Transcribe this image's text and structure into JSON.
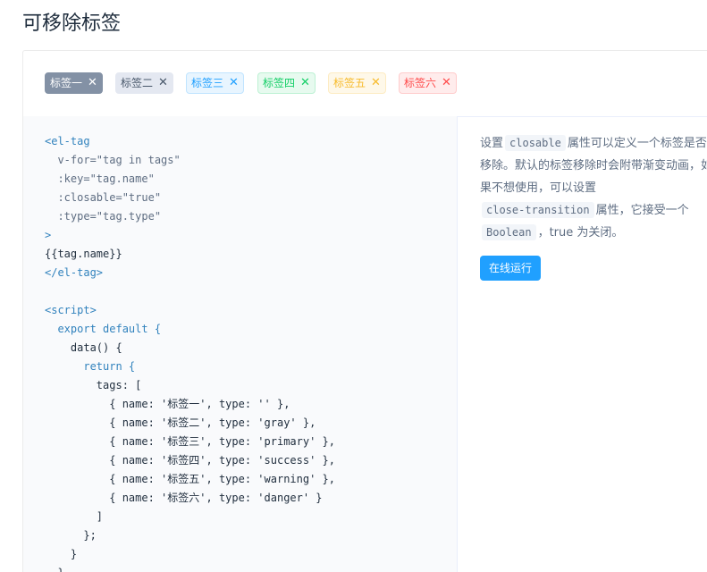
{
  "page": {
    "title": "可移除标签"
  },
  "tags": [
    {
      "label": "标签一",
      "type": "default",
      "close_icon": "close-icon"
    },
    {
      "label": "标签二",
      "type": "gray",
      "close_icon": "close-icon"
    },
    {
      "label": "标签三",
      "type": "primary",
      "close_icon": "close-icon"
    },
    {
      "label": "标签四",
      "type": "success",
      "close_icon": "close-icon"
    },
    {
      "label": "标签五",
      "type": "warning",
      "close_icon": "close-icon"
    },
    {
      "label": "标签六",
      "type": "danger",
      "close_icon": "close-icon"
    }
  ],
  "colors": {
    "default": "#8391a5",
    "gray": "#e4e8f1",
    "primary": "#20a0ff",
    "success": "#13ce66",
    "warning": "#f7ba2a",
    "danger": "#ff4949"
  },
  "code": {
    "lines": [
      "<el-tag",
      "  v-for=\"tag in tags\"",
      "  :key=\"tag.name\"",
      "  :closable=\"true\"",
      "  :type=\"tag.type\"",
      ">",
      "{{tag.name}}",
      "</el-tag>",
      "",
      "<script>",
      "  export default {",
      "    data() {",
      "      return {",
      "        tags: [",
      "          { name: '标签一', type: '' },",
      "          { name: '标签二', type: 'gray' },",
      "          { name: '标签三', type: 'primary' },",
      "          { name: '标签四', type: 'success' },",
      "          { name: '标签五', type: 'warning' },",
      "          { name: '标签六', type: 'danger' }",
      "        ]",
      "      };",
      "    }",
      "  }"
    ]
  },
  "description": {
    "part1": "设置",
    "code1": "closable",
    "part2": "属性可以定义一个标签是否可移除。默认的标签移除时会附带渐变动画，如果不想使用，可以设置",
    "code2": "close-transition",
    "part3": "属性，它接受一个",
    "code3": "Boolean",
    "part4": "，true 为关闭。",
    "run_label": "在线运行"
  }
}
